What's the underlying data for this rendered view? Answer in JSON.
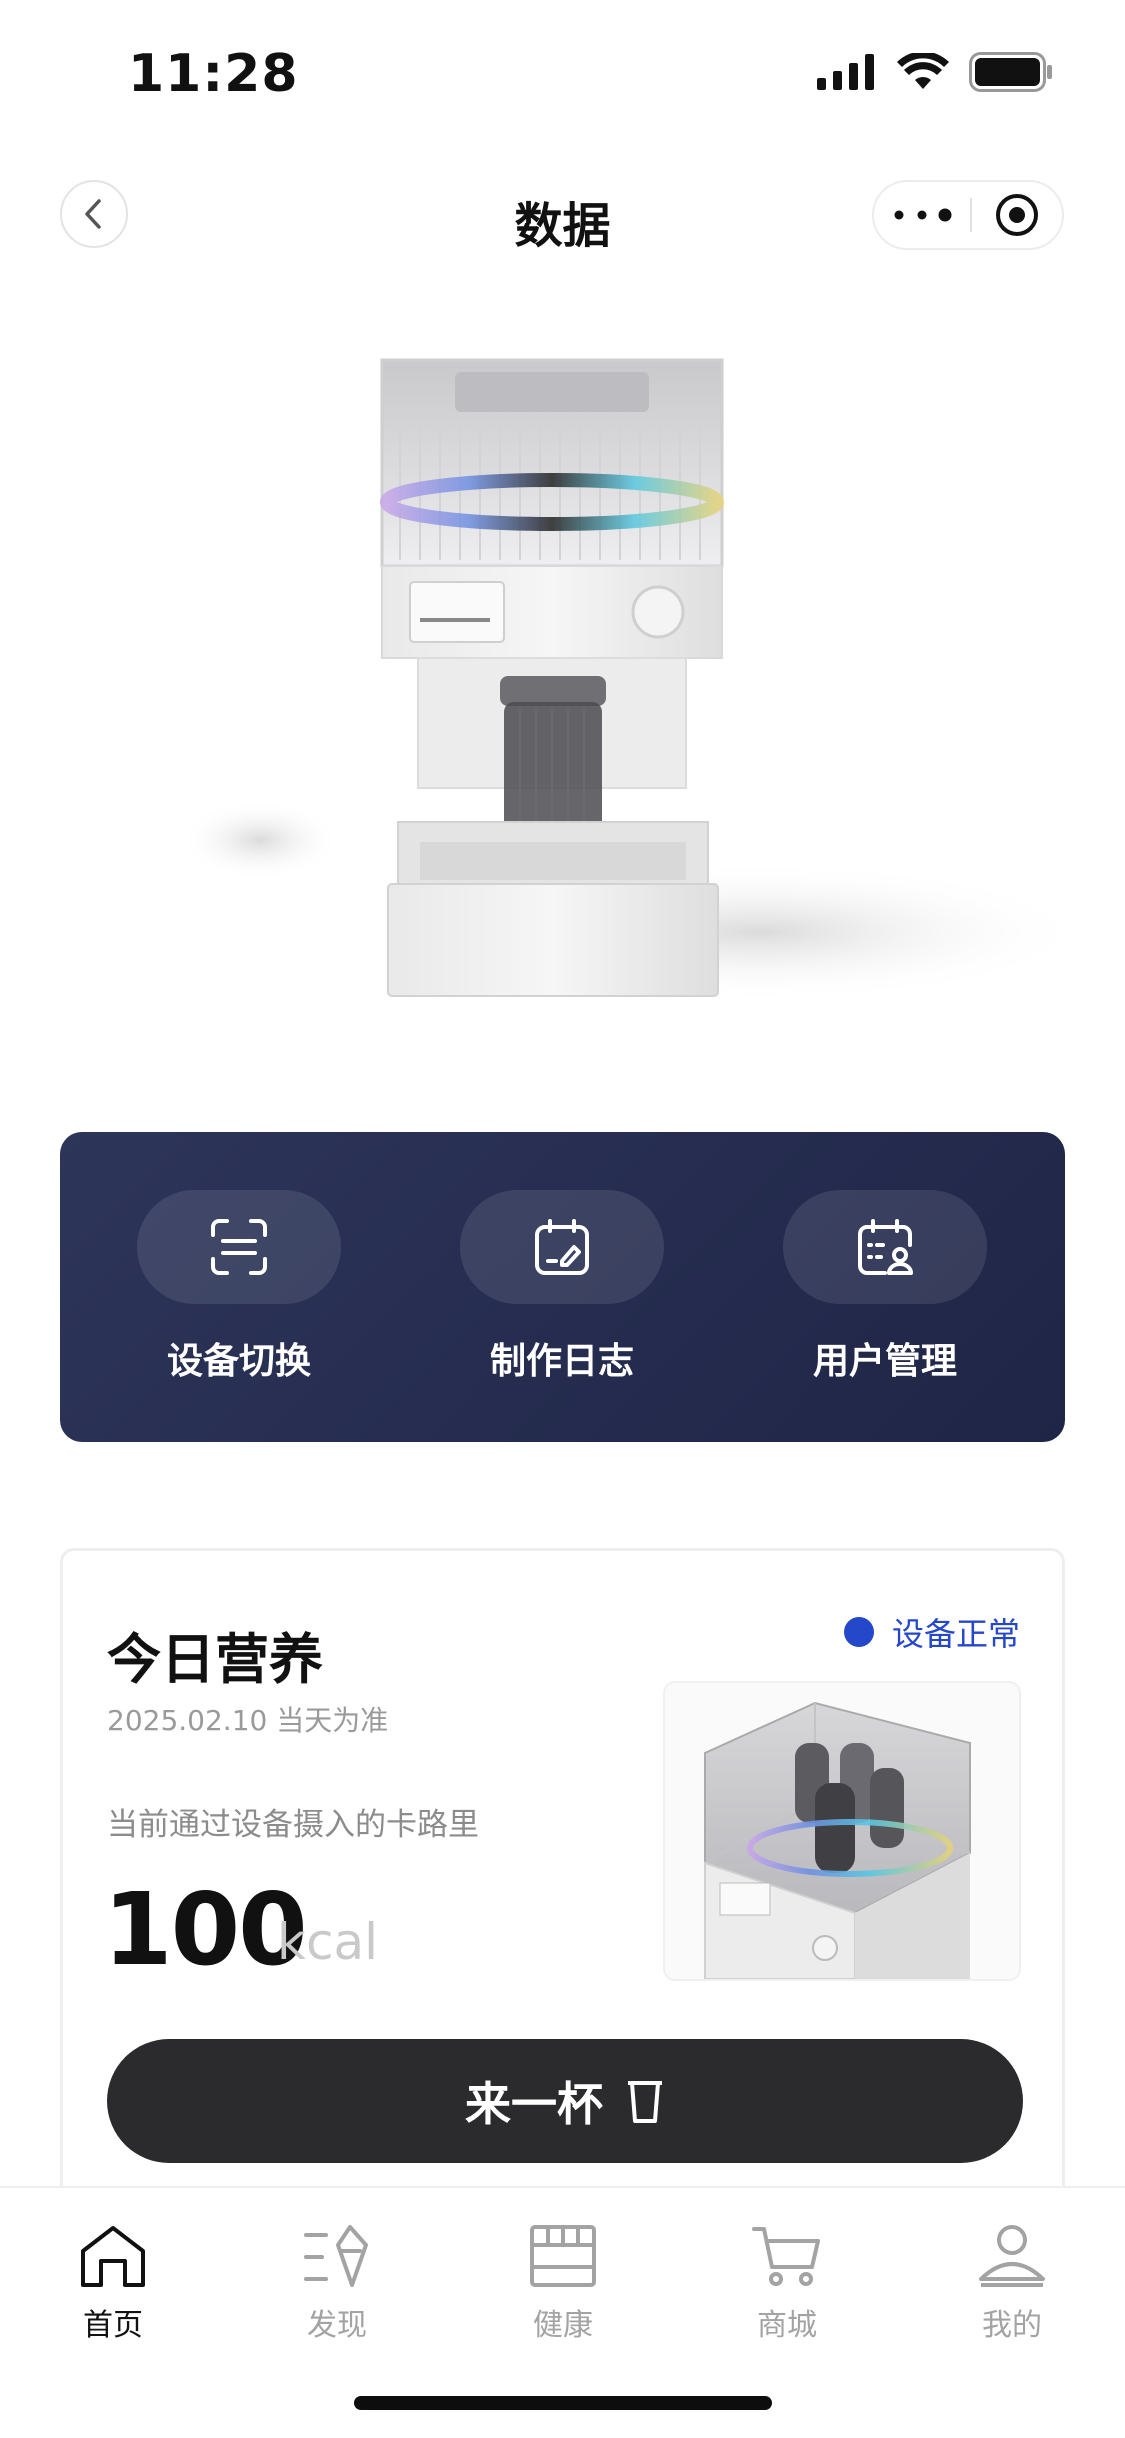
{
  "status_bar": {
    "time": "11:28"
  },
  "nav": {
    "title": "数据"
  },
  "functions": [
    {
      "label": "设备切换",
      "icon": "scan-switch-icon"
    },
    {
      "label": "制作日志",
      "icon": "calendar-edit-icon"
    },
    {
      "label": "用户管理",
      "icon": "calendar-user-icon"
    }
  ],
  "nutrition_card": {
    "title": "今日营养",
    "status": "设备正常",
    "date": "2025.02.10 当天为准",
    "desc": "当前通过设备摄入的卡路里",
    "calories": "100",
    "unit": "kcal",
    "button_label": "来一杯"
  },
  "tabs": [
    {
      "label": "首页",
      "active": true
    },
    {
      "label": "发现",
      "active": false
    },
    {
      "label": "健康",
      "active": false
    },
    {
      "label": "商城",
      "active": false
    },
    {
      "label": "我的",
      "active": false
    }
  ],
  "colors": {
    "panel": "#252c4f",
    "status_blue": "#2547c9",
    "button": "#2b2b2d"
  }
}
